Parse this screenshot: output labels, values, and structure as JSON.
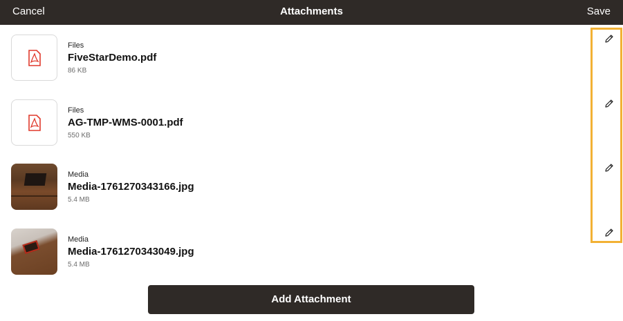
{
  "header": {
    "cancel_label": "Cancel",
    "title": "Attachments",
    "save_label": "Save"
  },
  "attachments": [
    {
      "category": "Files",
      "name": "FiveStarDemo.pdf",
      "size": "86 KB",
      "icon": "pdf-icon"
    },
    {
      "category": "Files",
      "name": "AG-TMP-WMS-0001.pdf",
      "size": "550 KB",
      "icon": "pdf-icon"
    },
    {
      "category": "Media",
      "name": "Media-1761270343166.jpg",
      "size": "5.4 MB",
      "icon": "photo-thumbnail"
    },
    {
      "category": "Media",
      "name": "Media-1761270343049.jpg",
      "size": "5.4 MB",
      "icon": "photo-thumbnail"
    }
  ],
  "add_button_label": "Add Attachment",
  "colors": {
    "header_bg": "#2f2a27",
    "pdf_red": "#e0392b",
    "highlight": "#f2b134"
  }
}
